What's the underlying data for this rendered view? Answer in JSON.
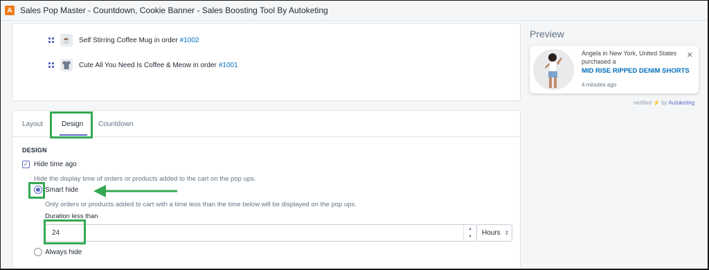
{
  "window": {
    "title": "Sales Pop Master - Countdown, Cookie Banner - Sales Boosting Tool By Autoketing",
    "logo_letter": "A"
  },
  "orders": [
    {
      "product": "Self Stirring Coffee Mug in order",
      "order_no": "#1002",
      "thumb_icon": "mug-icon"
    },
    {
      "product": "Cute All You Need Is Coffee & Meow in order",
      "order_no": "#1001",
      "thumb_icon": "tshirt-icon"
    }
  ],
  "tabs": [
    {
      "label": "Layout",
      "active": false
    },
    {
      "label": "Design",
      "active": true
    },
    {
      "label": "Countdown",
      "active": false
    }
  ],
  "design": {
    "section_title": "DESIGN",
    "hide_time_ago": {
      "label": "Hide time ago",
      "checked": true
    },
    "hide_help": "Hide the display time of orders or products added to the cart on the pop ups.",
    "smart_hide": {
      "label": "Smart hide",
      "selected": true
    },
    "smart_help": "Only orders or products added to cart with a time less than the time below will be displayed on the pop ups.",
    "duration_label": "Duration less than",
    "duration_value": "24",
    "units": "Hours",
    "always_hide": {
      "label": "Always hide",
      "selected": false
    }
  },
  "preview": {
    "title": "Preview",
    "line1": "Angela in New York, United States",
    "line2": "purchased a",
    "product": "MID RISE RIPPED DENIM SHORTS",
    "time": "4 minutes ago",
    "verified_prefix": "verified",
    "verified_by": "by",
    "brand": "Autoketing"
  },
  "colors": {
    "accent": "#5c6ac4",
    "link": "#006fbb",
    "highlight": "#34a853",
    "logo": "#f07d1a"
  }
}
